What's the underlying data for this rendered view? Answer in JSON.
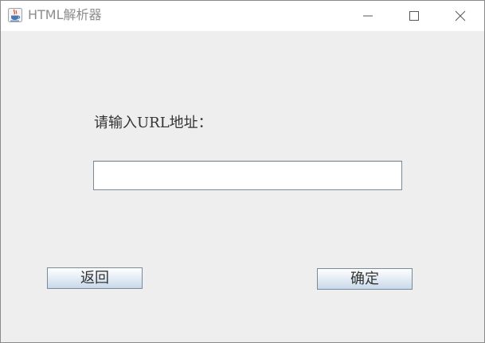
{
  "window": {
    "title": "HTML解析器",
    "app_icon": "java-cup-icon",
    "controls": {
      "minimize_icon": "minimize-icon",
      "maximize_icon": "maximize-icon",
      "close_icon": "close-icon"
    }
  },
  "form": {
    "prompt_label": "请输入URL地址：",
    "url_input": {
      "value": "",
      "placeholder": ""
    },
    "back_button": "返回",
    "confirm_button": "确定"
  },
  "colors": {
    "content_background": "#eeeeee",
    "titlebar_background": "#ffffff",
    "title_text": "#8c8c8c",
    "button_border": "#7a8a99"
  }
}
